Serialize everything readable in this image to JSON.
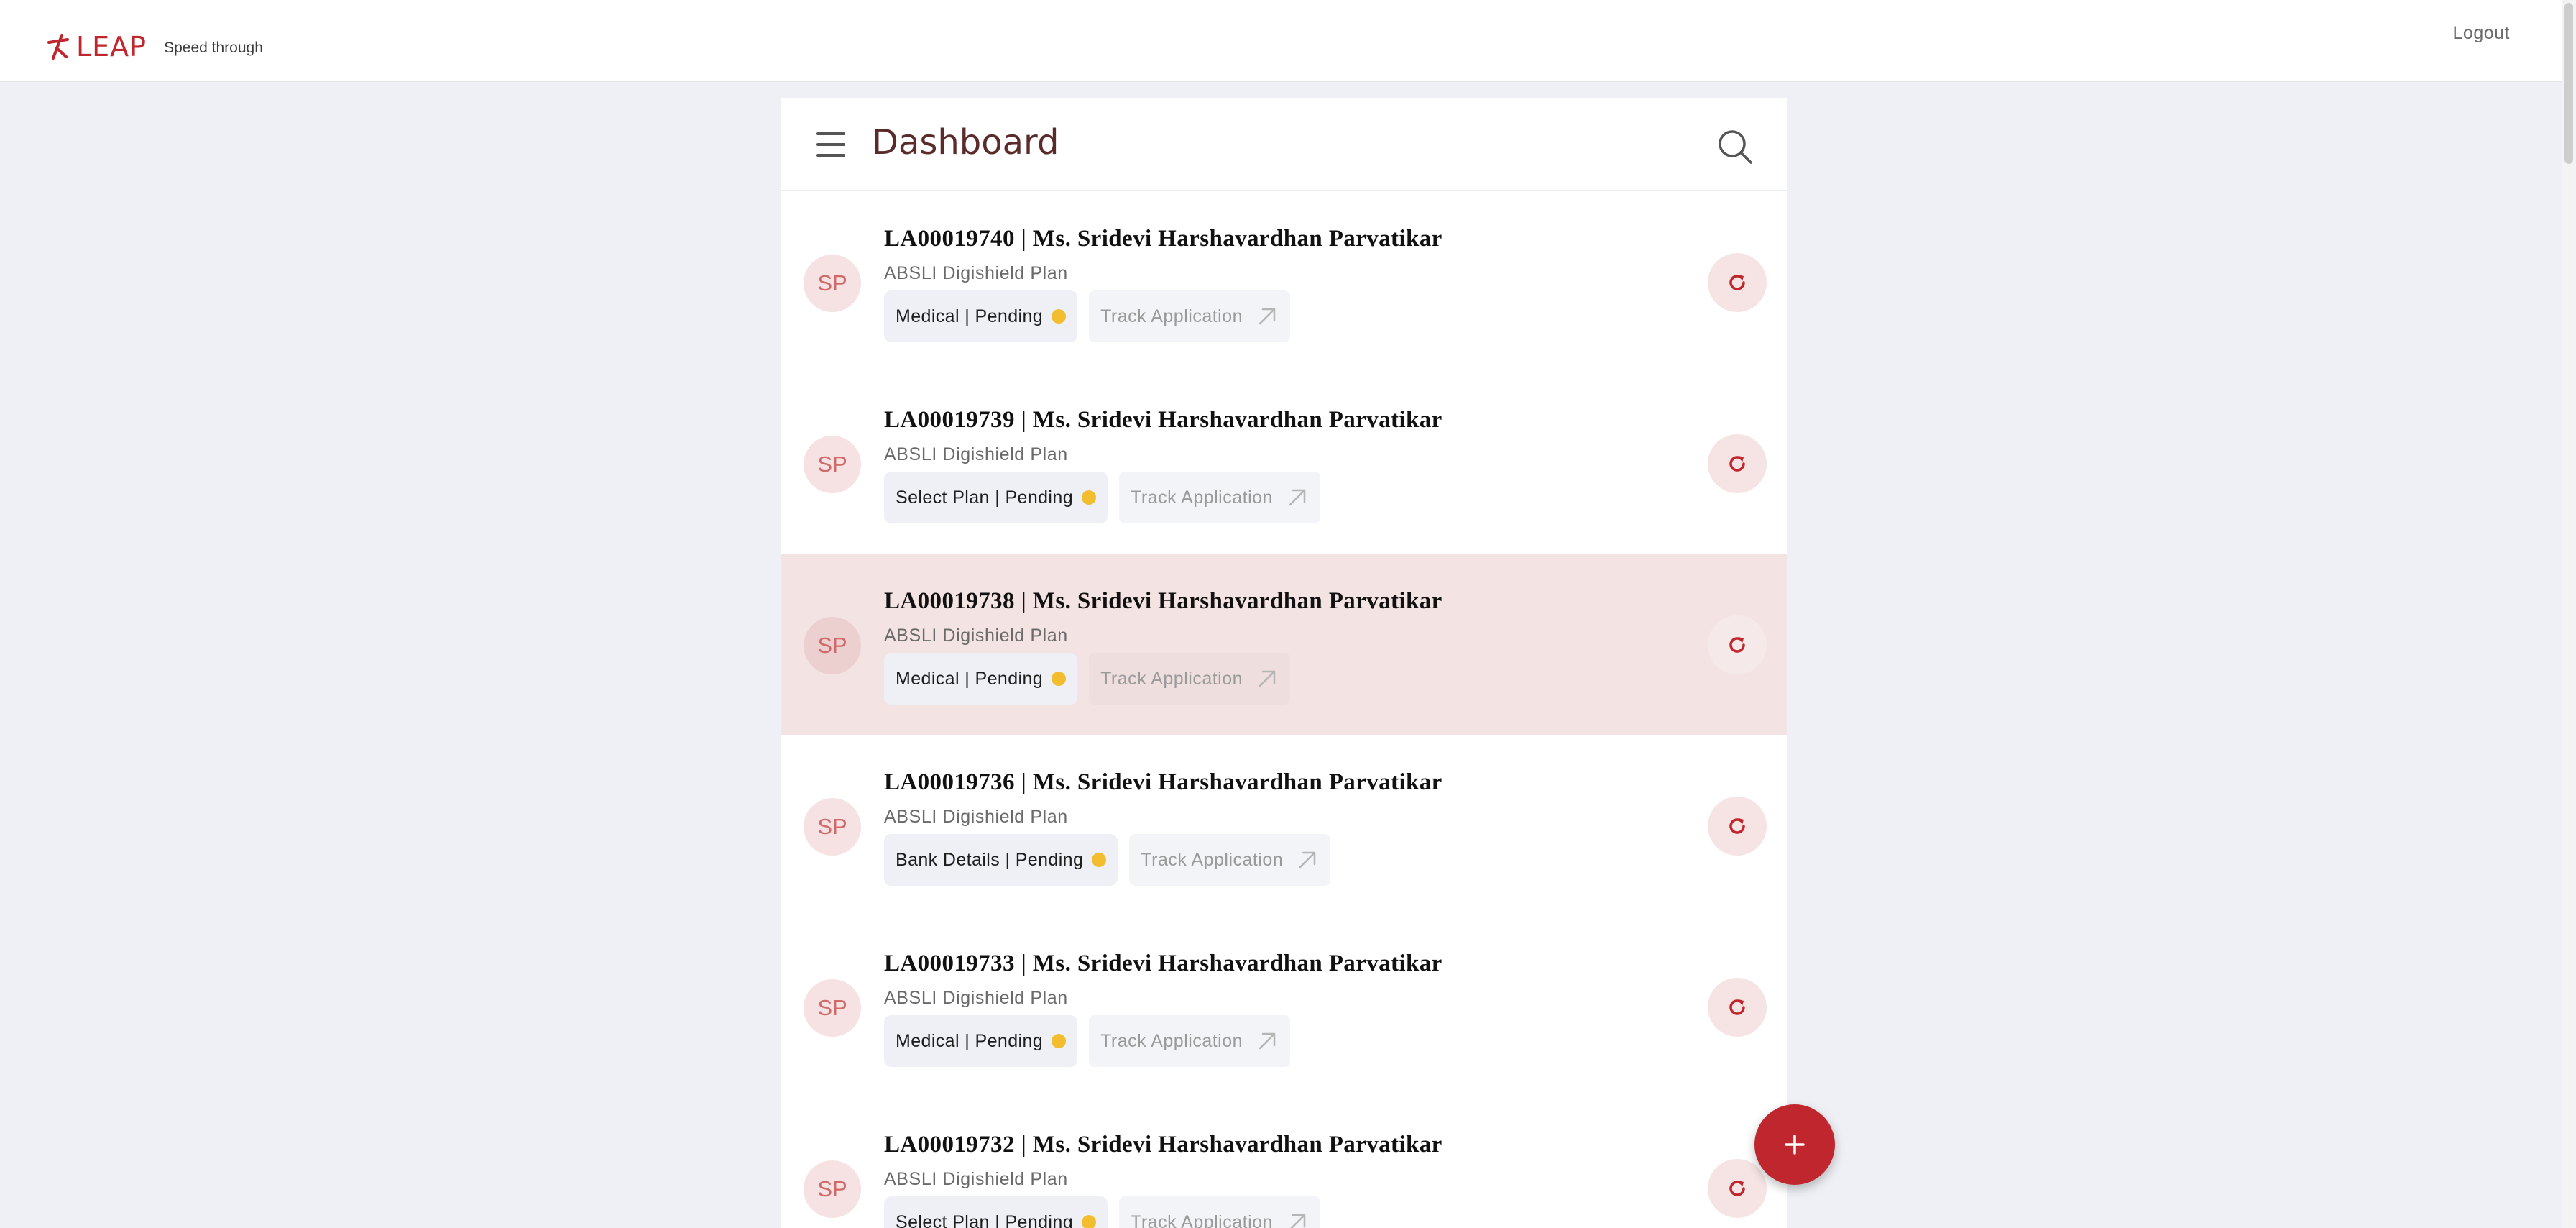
{
  "header": {
    "brand_name": "LEAP",
    "tagline": "Speed through",
    "logout_label": "Logout",
    "brand_color": "#c0262d"
  },
  "dashboard": {
    "title": "Dashboard",
    "icons": {
      "menu": "hamburger-menu-icon",
      "search": "search-icon",
      "refresh": "refresh-icon",
      "track": "arrow-up-right-icon",
      "add": "plus-icon"
    },
    "track_label": "Track Application",
    "status_dot_color": "#f2be2f",
    "rows": [
      {
        "avatar": "SP",
        "title": "LA00019740 | Ms. Sridevi Harshavardhan Parvatikar",
        "plan": "ABSLI Digishield Plan",
        "status": "Medical | Pending",
        "highlighted": false
      },
      {
        "avatar": "SP",
        "title": "LA00019739 | Ms. Sridevi Harshavardhan Parvatikar",
        "plan": "ABSLI Digishield Plan",
        "status": "Select Plan | Pending",
        "highlighted": false
      },
      {
        "avatar": "SP",
        "title": "LA00019738 | Ms. Sridevi Harshavardhan Parvatikar",
        "plan": "ABSLI Digishield Plan",
        "status": "Medical | Pending",
        "highlighted": true
      },
      {
        "avatar": "SP",
        "title": "LA00019736 | Ms. Sridevi Harshavardhan Parvatikar",
        "plan": "ABSLI Digishield Plan",
        "status": "Bank Details | Pending",
        "highlighted": false
      },
      {
        "avatar": "SP",
        "title": "LA00019733 | Ms. Sridevi Harshavardhan Parvatikar",
        "plan": "ABSLI Digishield Plan",
        "status": "Medical | Pending",
        "highlighted": false
      },
      {
        "avatar": "SP",
        "title": "LA00019732 | Ms. Sridevi Harshavardhan Parvatikar",
        "plan": "ABSLI Digishield Plan",
        "status": "Select Plan | Pending",
        "highlighted": false
      }
    ]
  }
}
